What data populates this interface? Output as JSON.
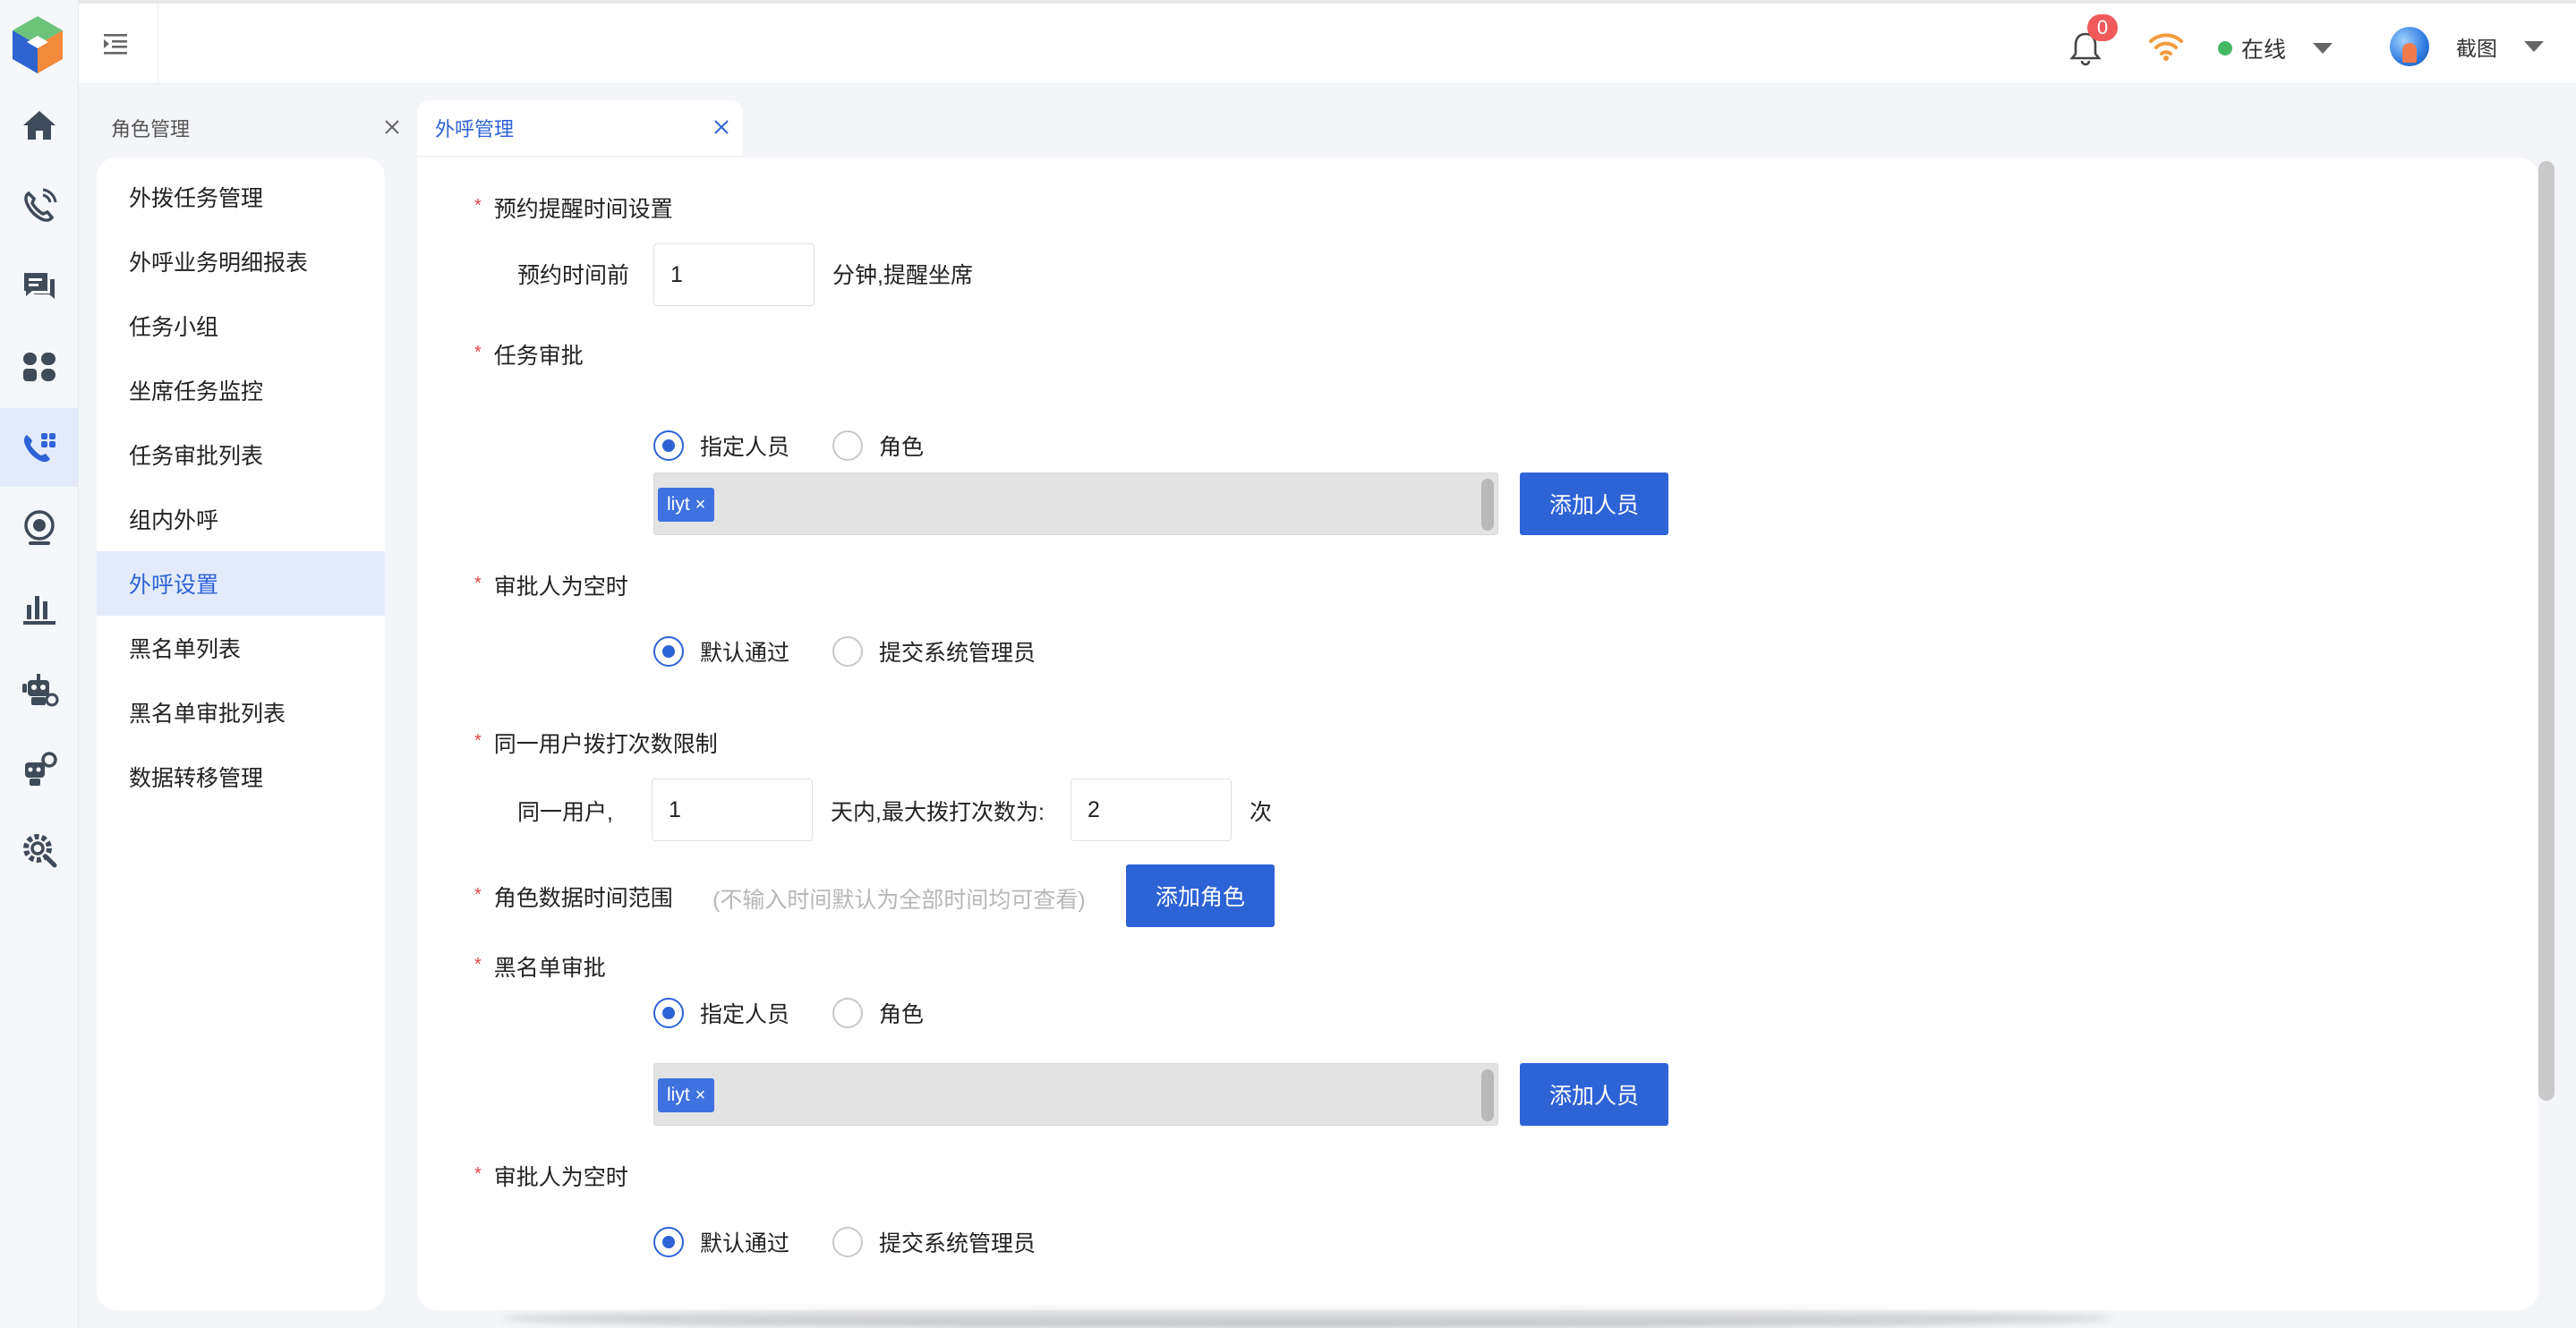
{
  "header": {
    "notification_count": "0",
    "status_text": "在线",
    "user_name": "截图"
  },
  "tabs": [
    {
      "label": "角色管理"
    },
    {
      "label": "外呼管理"
    }
  ],
  "subnav": [
    {
      "label": "外拨任务管理"
    },
    {
      "label": "外呼业务明细报表"
    },
    {
      "label": "任务小组"
    },
    {
      "label": "坐席任务监控"
    },
    {
      "label": "任务审批列表"
    },
    {
      "label": "组内外呼"
    },
    {
      "label": "外呼设置"
    },
    {
      "label": "黑名单列表"
    },
    {
      "label": "黑名单审批列表"
    },
    {
      "label": "数据转移管理"
    }
  ],
  "form": {
    "reminder": {
      "title": "预约提醒时间设置",
      "prefix": "预约时间前",
      "value": "1",
      "suffix": "分钟,提醒坐席"
    },
    "task_approval": {
      "title": "任务审批",
      "option_person": "指定人员",
      "option_role": "角色",
      "tag": "liyt",
      "add_button": "添加人员"
    },
    "approver_empty_1": {
      "title": "审批人为空时",
      "option_default": "默认通过",
      "option_admin": "提交系统管理员"
    },
    "dial_limit": {
      "title": "同一用户拨打次数限制",
      "prefix": "同一用户,",
      "days_value": "1",
      "middle": "天内,最大拨打次数为:",
      "max_value": "2",
      "suffix": "次"
    },
    "role_time_range": {
      "title": "角色数据时间范围",
      "hint": "(不输入时间默认为全部时间均可查看)",
      "add_button": "添加角色"
    },
    "blacklist_approval": {
      "title": "黑名单审批",
      "option_person": "指定人员",
      "option_role": "角色",
      "tag": "liyt",
      "add_button": "添加人员"
    },
    "approver_empty_2": {
      "title": "审批人为空时",
      "option_default": "默认通过",
      "option_admin": "提交系统管理员"
    }
  },
  "colors": {
    "primary": "#2e63d6",
    "required": "#e64545",
    "badge": "#f05a5a",
    "online": "#43b864"
  }
}
